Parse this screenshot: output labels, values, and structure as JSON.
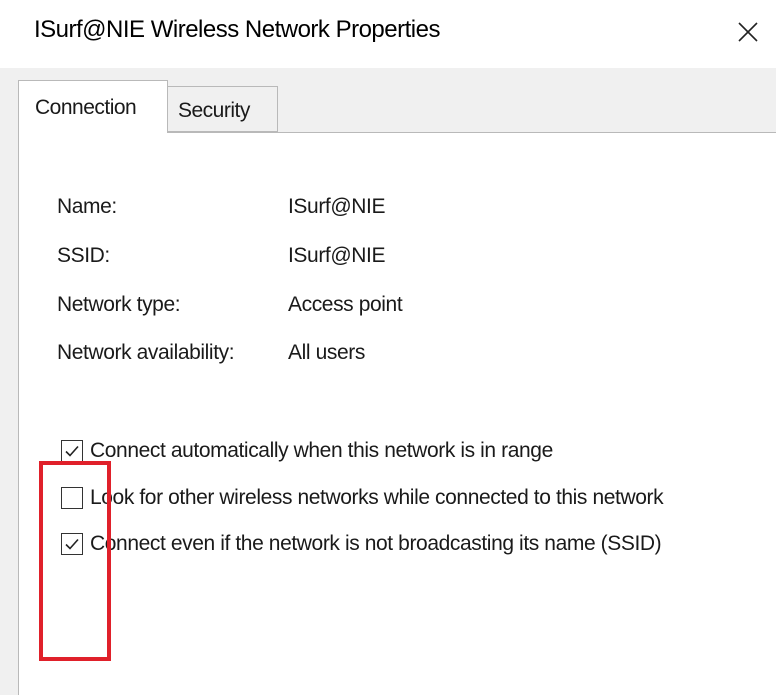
{
  "window": {
    "title": "ISurf@NIE Wireless Network Properties"
  },
  "tabs": [
    {
      "label": "Connection",
      "selected": true
    },
    {
      "label": "Security",
      "selected": false
    }
  ],
  "connection": {
    "info": [
      {
        "label": "Name:",
        "value": "ISurf@NIE"
      },
      {
        "label": "SSID:",
        "value": "ISurf@NIE"
      },
      {
        "label": "Network type:",
        "value": "Access point"
      },
      {
        "label": "Network availability:",
        "value": "All users"
      }
    ],
    "options": [
      {
        "label": "Connect automatically when this network is in range",
        "checked": true
      },
      {
        "label": "Look for other wireless networks while connected to this network",
        "checked": false
      },
      {
        "label": "Connect even if the network is not broadcasting its name (SSID)",
        "checked": true
      }
    ]
  },
  "annotation": {
    "highlight_color": "#e0202a"
  }
}
